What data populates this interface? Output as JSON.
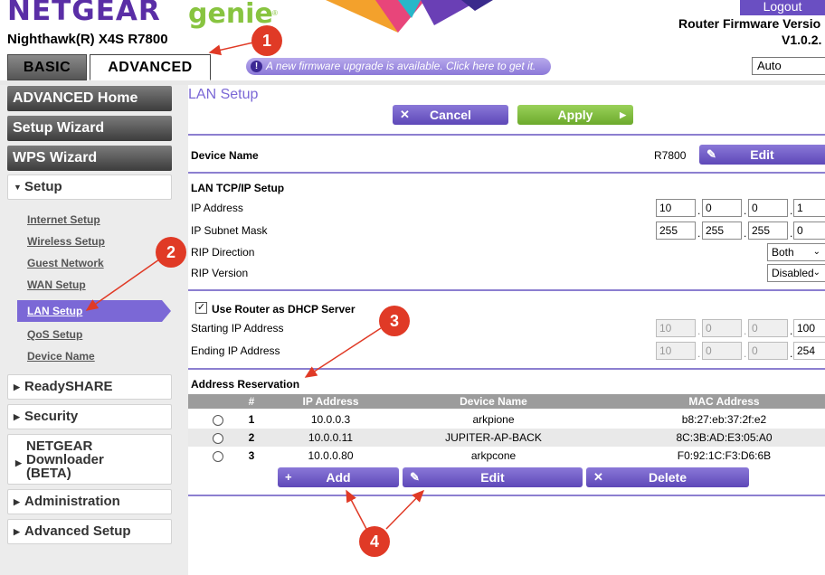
{
  "header": {
    "brand": "NETGEAR",
    "brand_sub": "genie",
    "trademark": "®",
    "model": "Nighthawk(R) X4S R7800",
    "logout_label": "Logout",
    "firmware_label": "Router Firmware Versio",
    "firmware_version": "V1.0.2.",
    "language": "Auto",
    "notice": "A new firmware upgrade is available. Click here to get it.",
    "notice_icon": "!"
  },
  "tabs": [
    {
      "label": "BASIC"
    },
    {
      "label": "ADVANCED"
    }
  ],
  "sidebar": {
    "buttons": [
      {
        "label": "ADVANCED Home"
      },
      {
        "label": "Setup Wizard"
      },
      {
        "label": "WPS Wizard"
      }
    ],
    "setup_label": "Setup",
    "sub_items": [
      "Internet Setup",
      "Wireless Setup",
      "Guest Network",
      "WAN Setup",
      "LAN Setup",
      "QoS Setup",
      "Device Name"
    ],
    "groups": [
      "ReadySHARE",
      "Security",
      "NETGEAR",
      "Downloader",
      "(BETA)",
      "Administration",
      "Advanced Setup"
    ]
  },
  "main": {
    "title": "LAN Setup",
    "cancel_label": "Cancel",
    "apply_label": "Apply",
    "device_name_label": "Device Name",
    "device_name_value": "R7800",
    "edit_label": "Edit",
    "tcpip_title": "LAN TCP/IP Setup",
    "ip_label": "IP Address",
    "ip": [
      "10",
      "0",
      "0",
      "1"
    ],
    "mask_label": "IP Subnet Mask",
    "mask": [
      "255",
      "255",
      "255",
      "0"
    ],
    "rip_dir_label": "RIP Direction",
    "rip_dir_value": "Both",
    "rip_ver_label": "RIP Version",
    "rip_ver_value": "Disabled",
    "dhcp_label": "Use Router as DHCP Server",
    "start_label": "Starting IP Address",
    "start_ip": [
      "10",
      "0",
      "0",
      "100"
    ],
    "end_label": "Ending IP Address",
    "end_ip": [
      "10",
      "0",
      "0",
      "254"
    ],
    "reservation_title": "Address Reservation",
    "columns": [
      "#",
      "IP Address",
      "Device Name",
      "MAC Address"
    ],
    "rows": [
      {
        "num": "1",
        "ip": "10.0.0.3",
        "name": "arkpione",
        "mac": "b8:27:eb:37:2f:e2"
      },
      {
        "num": "2",
        "ip": "10.0.0.11",
        "name": "JUPITER-AP-BACK",
        "mac": "8C:3B:AD:E3:05:A0"
      },
      {
        "num": "3",
        "ip": "10.0.0.80",
        "name": "arkpcone",
        "mac": "F0:92:1C:F3:D6:6B"
      }
    ],
    "add_label": "Add",
    "edit2_label": "Edit",
    "delete_label": "Delete"
  },
  "callouts": [
    "1",
    "2",
    "3",
    "4"
  ],
  "colors": {
    "brand_purple": "#5a2ea6",
    "brand_green": "#88c440",
    "accent_purple": "#7b68d6",
    "apply_green": "#7dbd3a",
    "callout_red": "#e03a26"
  }
}
